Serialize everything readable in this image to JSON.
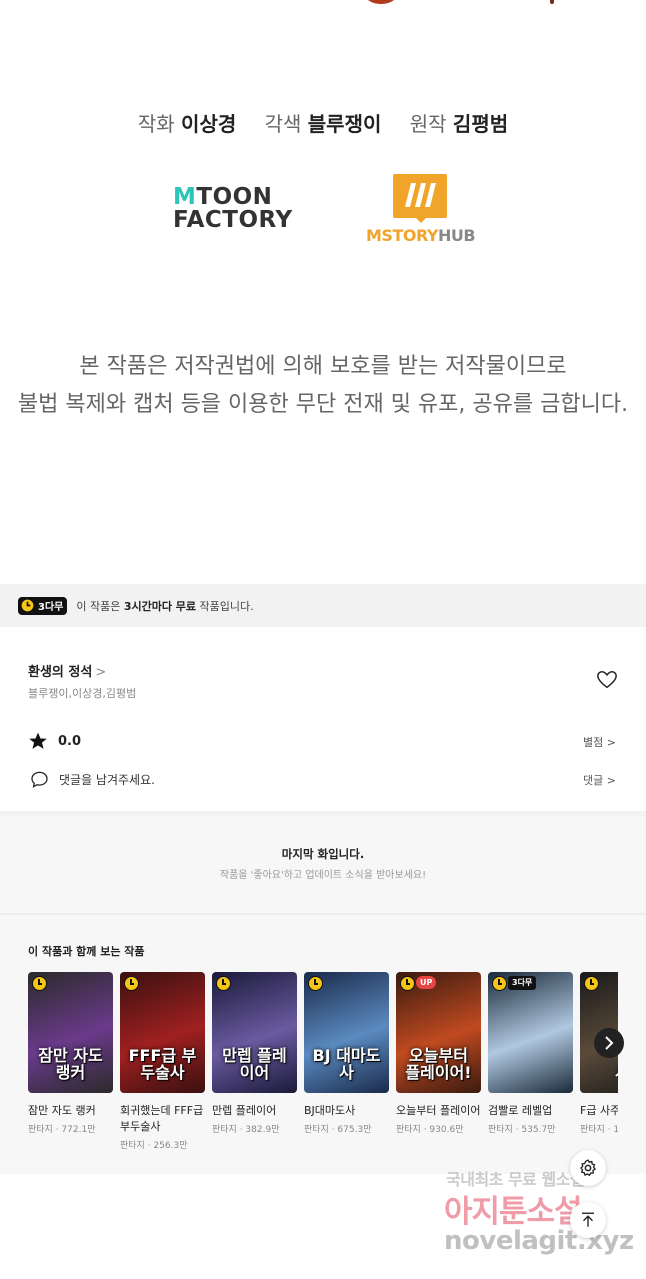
{
  "credits": {
    "art_role": "작화",
    "art_name": "이상경",
    "color_role": "각색",
    "color_name": "블루쟁이",
    "orig_role": "원작",
    "orig_name": "김평범"
  },
  "logos": {
    "mtoon_line1_m": "M",
    "mtoon_line1_rest": "TOON",
    "mtoon_line2": "FACTORY",
    "mstory_text": "MSTORY",
    "mstory_hub": "HUB"
  },
  "copyright": {
    "line1": "본 작품은 저작권법에 의해 보호를 받는 저작물이므로",
    "line2": "불법 복제와 캡처 등을 이용한 무단 전재 및 유포, 공유를 금합니다."
  },
  "free_bar": {
    "tag": "3다무",
    "text_pre": "이 작품은 ",
    "text_bold": "3시간마다 무료",
    "text_post": " 작품입니다."
  },
  "work": {
    "title": "환생의 정석",
    "title_chevron": ">",
    "authors": "블루쟁이,이상경,김평범",
    "rating": "0.0",
    "rating_link": "별점 >",
    "comment_placeholder": "댓글을 남겨주세요.",
    "comment_link": "댓글 >"
  },
  "last_episode": {
    "heading": "마지막 화입니다.",
    "sub": "작품을 '좋아요'하고 업데이트 소식을 받아보세요!"
  },
  "recommendations": {
    "heading": "이 작품과 함께 보는 작품",
    "items": [
      {
        "title": "잠만 자도 랭커",
        "meta": "판타지 · 772.1만",
        "cover_text": "잠만 자도 랭커",
        "colors": [
          "#2a2a2a",
          "#6a3a8a"
        ],
        "badge": "clock",
        "extra": ""
      },
      {
        "title": "회귀했는데 FFF급 부두술사",
        "meta": "판타지 · 256.3만",
        "cover_text": "FFF급 부두술사",
        "colors": [
          "#3a1010",
          "#a02020"
        ],
        "badge": "clock",
        "extra": ""
      },
      {
        "title": "만렙 플레이어",
        "meta": "판타지 · 382.9만",
        "cover_text": "만렙 플레이어",
        "colors": [
          "#1a1a3a",
          "#6a5aa0"
        ],
        "badge": "clock",
        "extra": ""
      },
      {
        "title": "BJ대마도사",
        "meta": "판타지 · 675.3만",
        "cover_text": "BJ 대마도사",
        "colors": [
          "#1a2a4a",
          "#5a8ac0"
        ],
        "badge": "clock",
        "extra": ""
      },
      {
        "title": "오늘부터 플레이어",
        "meta": "판타지 · 930.6만",
        "cover_text": "오늘부터 플레이어!",
        "colors": [
          "#3a1a10",
          "#c04a20"
        ],
        "badge": "clock",
        "extra": "UP"
      },
      {
        "title": "검빨로 레벨업",
        "meta": "판타지 · 535.7만",
        "cover_text": "",
        "colors": [
          "#1a2a3a",
          "#b0c8e0"
        ],
        "badge": "clock",
        "extra": "3다무"
      },
      {
        "title": "F급 사주",
        "meta": "판타지 · 1",
        "cover_text": "사",
        "colors": [
          "#1a1a1a",
          "#5a4a3a"
        ],
        "badge": "clock",
        "extra": ""
      }
    ]
  },
  "watermark": {
    "line1": "국내최초 무료 웹소설",
    "line2": "아지툰소설",
    "line3": "novelagit.xyz"
  },
  "colors": {
    "accent_yellow": "#f5c518",
    "mstory_orange": "#f0a42a",
    "mtoon_teal": "#2ec4b6",
    "up_red": "#e84545"
  },
  "icons": {
    "heart": "heart-outline-icon",
    "star": "star-icon",
    "comment": "comment-bubble-icon",
    "next": "chevron-right-icon",
    "gear": "gear-icon",
    "top": "arrow-up-to-top-icon"
  }
}
